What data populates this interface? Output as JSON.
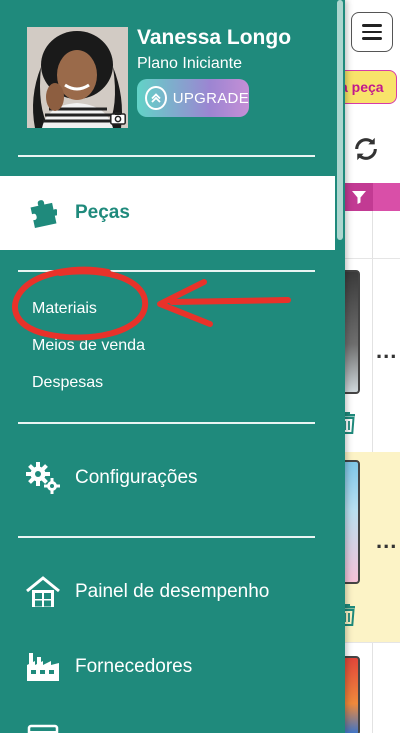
{
  "background": {
    "chip_label": "a peça",
    "colors": {
      "chip_bg": "#f8e36a",
      "chip_border": "#d63ca8",
      "filter_bar": "#d94fa8",
      "highlight_row": "#fcf3c6"
    },
    "row_actions": "..."
  },
  "drawer": {
    "user": {
      "name": "Vanessa Longo",
      "plan": "Plano Iniciante",
      "upgrade_label": "UPGRADE"
    },
    "active_item": {
      "label": "Peças",
      "icon": "puzzle-icon"
    },
    "sub_items": [
      "Materiais",
      "Meios de venda",
      "Despesas"
    ],
    "menu_items": [
      {
        "label": "Configurações",
        "icon": "gears-icon"
      },
      {
        "label": "Painel de desempenho",
        "icon": "house-icon"
      },
      {
        "label": "Fornecedores",
        "icon": "factory-icon"
      }
    ],
    "colors": {
      "drawer_bg": "#1f8a7c",
      "active_bg": "#ffffff",
      "accent": "#1f8a7c"
    }
  },
  "annotation": {
    "color": "#e8322a",
    "shape": "circle-and-arrow"
  }
}
